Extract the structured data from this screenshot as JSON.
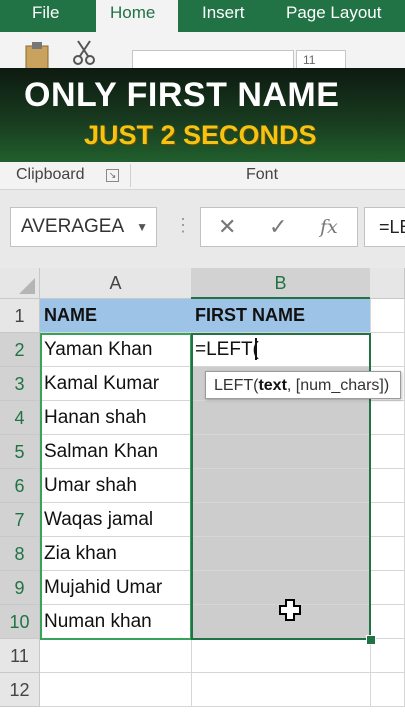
{
  "ribbon": {
    "tabs": [
      {
        "label": "File"
      },
      {
        "label": "Home"
      },
      {
        "label": "Insert"
      },
      {
        "label": "Page Layout"
      }
    ],
    "font_size_value": "11",
    "groups": {
      "clipboard": "Clipboard",
      "font": "Font"
    }
  },
  "banner": {
    "line1": "ONLY FIRST NAME",
    "line2": "JUST 2 SECONDS",
    "accent_color": "#f6c312"
  },
  "formula_bar": {
    "name_box": "AVERAGEA",
    "formula": "=LE",
    "cancel_icon": "close-icon",
    "enter_icon": "check-icon",
    "function_icon": "fx-icon"
  },
  "sheet": {
    "columns": [
      "A",
      "B"
    ],
    "rows": [
      "1",
      "2",
      "3",
      "4",
      "5",
      "6",
      "7",
      "8",
      "9",
      "10",
      "11",
      "12"
    ],
    "header": {
      "a": "NAME",
      "b": "FIRST NAME"
    },
    "names": [
      "Yaman Khan",
      "Kamal Kumar",
      "Hanan shah",
      "Salman Khan",
      "Umar shah",
      "Waqas jamal",
      "Zia khan",
      "Mujahid Umar",
      "Numan khan"
    ],
    "active_cell_text": "=LEFT(",
    "tooltip": {
      "fn": "LEFT(",
      "arg1": "text",
      "rest": ", [num_chars])"
    },
    "header_fill_color": "#9dc3e6",
    "selection_color": "#217346"
  }
}
